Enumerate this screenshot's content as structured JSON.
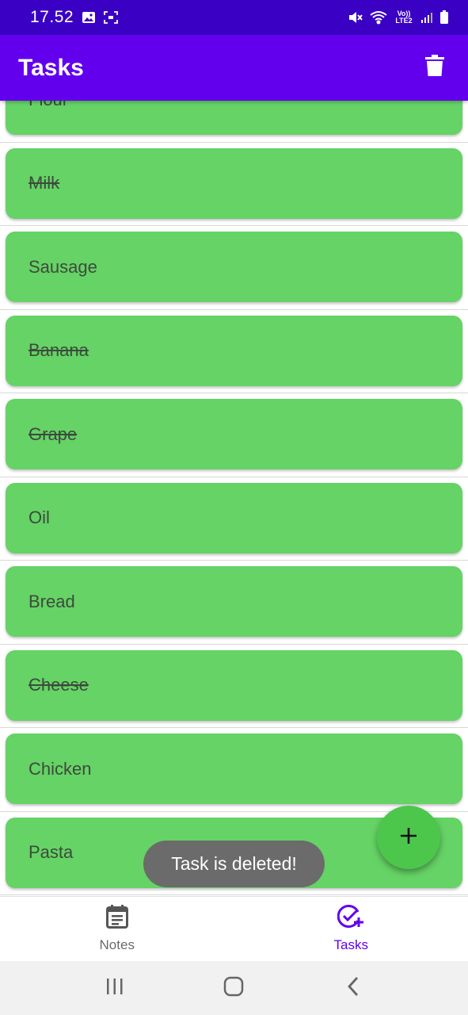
{
  "status_bar": {
    "time": "17.52",
    "network_label": "Vo)) LTE2",
    "icons": [
      "image-icon",
      "screenshot-icon",
      "mute-icon",
      "wifi-icon",
      "signal-icon",
      "battery-icon"
    ]
  },
  "app_bar": {
    "title": "Tasks",
    "action_icon": "trash-icon"
  },
  "tasks": [
    {
      "label": "Flour",
      "done": false
    },
    {
      "label": "Milk",
      "done": true
    },
    {
      "label": "Sausage",
      "done": false
    },
    {
      "label": "Banana",
      "done": true
    },
    {
      "label": "Grape",
      "done": true
    },
    {
      "label": "Oil",
      "done": false
    },
    {
      "label": "Bread",
      "done": false
    },
    {
      "label": "Cheese",
      "done": true
    },
    {
      "label": "Chicken",
      "done": false
    },
    {
      "label": "Pasta",
      "done": false
    }
  ],
  "fab": {
    "icon": "plus-icon"
  },
  "toast": {
    "message": "Task is deleted!"
  },
  "bottom_nav": {
    "items": [
      {
        "label": "Notes",
        "icon": "calendar-note-icon",
        "active": false
      },
      {
        "label": "Tasks",
        "icon": "check-add-icon",
        "active": true
      }
    ]
  },
  "system_nav": {
    "buttons": [
      "recents-icon",
      "home-icon",
      "back-icon"
    ]
  },
  "colors": {
    "status_bar": "#3a00c4",
    "app_bar": "#6200ee",
    "card": "#65d365",
    "fab": "#4cc74c",
    "toast": "#6b6b6b",
    "active_nav": "#6200ee"
  }
}
